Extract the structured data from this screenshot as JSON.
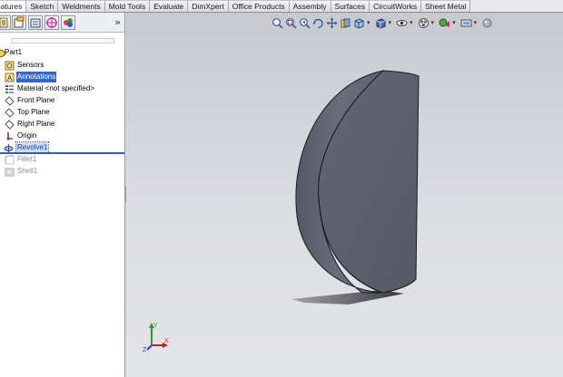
{
  "command_tabs": [
    {
      "label": "eatures",
      "active": true
    },
    {
      "label": "Sketch"
    },
    {
      "label": "Weldments"
    },
    {
      "label": "Mold Tools"
    },
    {
      "label": "Evaluate"
    },
    {
      "label": "DimXpert"
    },
    {
      "label": "Office Products"
    },
    {
      "label": "Assembly"
    },
    {
      "label": "Surfaces"
    },
    {
      "label": "CircuitWorks"
    },
    {
      "label": "Sheet Metal"
    }
  ],
  "panel": {
    "tab_icons": [
      "feature-manager-icon",
      "property-manager-icon",
      "configuration-manager-icon",
      "dimxpert-manager-icon",
      "display-manager-icon"
    ],
    "expand_glyph": "»"
  },
  "tree": {
    "items": [
      {
        "label": "Part1",
        "icon": "part-icon",
        "state": "normal"
      },
      {
        "label": "Sensors",
        "icon": "sensors-icon",
        "state": "normal"
      },
      {
        "label": "Annotations",
        "icon": "annotations-icon",
        "state": "selected"
      },
      {
        "label": "Material <not specified>",
        "icon": "material-icon",
        "state": "normal"
      },
      {
        "label": "Front Plane",
        "icon": "plane-icon",
        "state": "normal"
      },
      {
        "label": "Top Plane",
        "icon": "plane-icon",
        "state": "normal"
      },
      {
        "label": "Right Plane",
        "icon": "plane-icon",
        "state": "normal"
      },
      {
        "label": "Origin",
        "icon": "origin-icon",
        "state": "normal"
      },
      {
        "label": "Revolve1",
        "icon": "revolve-icon",
        "state": "highlighted"
      },
      {
        "label": "Fillet1",
        "icon": "fillet-icon",
        "state": "suppressed"
      },
      {
        "label": "Shell1",
        "icon": "shell-icon",
        "state": "suppressed"
      }
    ]
  },
  "heads_up_toolbar": [
    "zoom-to-fit-icon",
    "zoom-to-area-icon",
    "previous-view-icon",
    "rotate-view-icon",
    "pan-icon",
    "section-view-icon",
    "view-orientation-icon",
    "display-style-icon",
    "hide-show-items-icon",
    "edit-appearance-icon",
    "apply-scene-icon",
    "view-settings-icon",
    "realview-icon"
  ],
  "colors": {
    "selection": "#3568c4",
    "model_face": "#5c5f6e",
    "model_shadow": "#3c3e46"
  }
}
